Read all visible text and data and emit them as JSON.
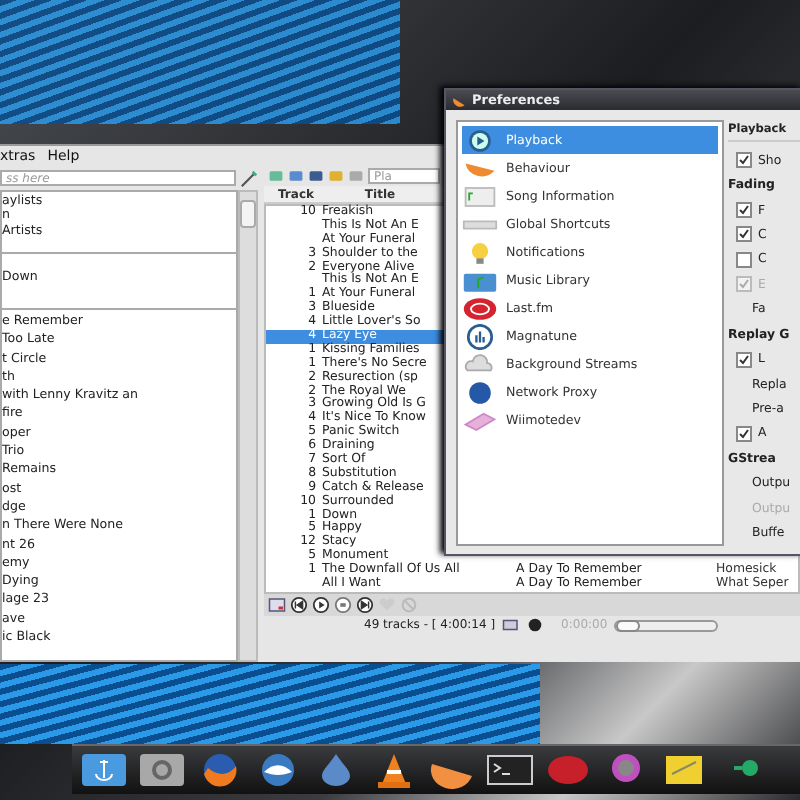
{
  "main_window": {
    "menu": [
      "xtras",
      "Help"
    ],
    "library": {
      "search": {
        "placeholder": "ss here"
      },
      "sections": [
        [
          "aylists",
          "n",
          "Artists"
        ],
        [
          "Down"
        ],
        [
          "e Remember",
          "Too Late",
          "t Circle",
          "th",
          "with Lenny Kravitz an",
          "fire",
          "oper",
          "Trio",
          "Remains",
          "ost",
          "dge",
          "n There Were None",
          "nt 26",
          "emy",
          "Dying",
          "lage 23",
          "ave",
          "ic Black"
        ]
      ]
    },
    "playlist": {
      "search": {
        "placeholder": "Pla"
      },
      "columns": [
        "Track",
        "Title"
      ],
      "rows": [
        {
          "track": "10",
          "title": "Freakish",
          "selected": false
        },
        {
          "title": "This Is Not An E",
          "selected": false
        },
        {
          "title": "At Your Funeral",
          "selected": false
        },
        {
          "track": "3",
          "title": "Shoulder to the",
          "selected": false
        },
        {
          "track": "2",
          "title": "Everyone Alive",
          "selected": false
        },
        {
          "title": "This Is Not An E",
          "selected": false
        },
        {
          "track": "1",
          "title": "At Your Funeral",
          "selected": false
        },
        {
          "track": "3",
          "title": "Blueside",
          "selected": false
        },
        {
          "track": "4",
          "title": "Little Lover's So",
          "selected": false
        },
        {
          "track": "4",
          "title": "Lazy Eye",
          "selected": true
        },
        {
          "track": "1",
          "title": "Kissing Families",
          "selected": false
        },
        {
          "track": "1",
          "title": "There's No Secre",
          "selected": false
        },
        {
          "track": "2",
          "title": "Resurection (sp",
          "selected": false
        },
        {
          "track": "2",
          "title": "The Royal We",
          "selected": false
        },
        {
          "track": "3",
          "title": "Growing Old Is G",
          "selected": false
        },
        {
          "track": "4",
          "title": "It's Nice To Know",
          "selected": false
        },
        {
          "track": "5",
          "title": "Panic Switch",
          "selected": false
        },
        {
          "track": "6",
          "title": "Draining",
          "selected": false
        },
        {
          "track": "7",
          "title": "Sort Of",
          "selected": false
        },
        {
          "track": "8",
          "title": "Substitution",
          "selected": false
        },
        {
          "track": "9",
          "title": "Catch & Release",
          "selected": false
        },
        {
          "track": "10",
          "title": "Surrounded",
          "selected": false
        },
        {
          "track": "1",
          "title": "Down",
          "selected": false
        },
        {
          "track": "5",
          "title": "Happy",
          "selected": false
        },
        {
          "track": "12",
          "title": "Stacy",
          "selected": false
        },
        {
          "track": "5",
          "title": "Monument",
          "selected": false
        },
        {
          "track": "1",
          "title": "The Downfall Of Us All",
          "artist": "A Day To Remember",
          "album": "Homesick",
          "selected": false
        },
        {
          "title": "All I Want",
          "artist": "A Day To Remember",
          "album": "What Seper",
          "selected": false
        }
      ]
    },
    "status": {
      "tracks": "49 tracks - [ 4:00:14 ]",
      "time": "0:00:00",
      "level": 0
    }
  },
  "preferences": {
    "title": "Preferences",
    "pages": [
      {
        "label": "Playback",
        "selected": true
      },
      {
        "label": "Behaviour",
        "selected": false
      },
      {
        "label": "Song Information",
        "selected": false
      },
      {
        "label": "Global Shortcuts",
        "selected": false
      },
      {
        "label": "Notifications",
        "selected": false
      },
      {
        "label": "Music Library",
        "selected": false
      },
      {
        "label": "Last.fm",
        "selected": false
      },
      {
        "label": "Magnatune",
        "selected": false
      },
      {
        "label": "Background Streams",
        "selected": false
      },
      {
        "label": "Network Proxy",
        "selected": false
      },
      {
        "label": "Wiimotedev",
        "selected": false
      }
    ],
    "settings": [
      {
        "kind": "title",
        "text": "Playback"
      },
      {
        "kind": "check",
        "text": "Sho",
        "checked": true,
        "disabled": false
      },
      {
        "kind": "heading",
        "text": "Fading"
      },
      {
        "kind": "check",
        "text": "F",
        "checked": true,
        "disabled": false
      },
      {
        "kind": "check",
        "text": "C",
        "checked": true,
        "disabled": false
      },
      {
        "kind": "check",
        "text": "C",
        "checked": false,
        "disabled": false
      },
      {
        "kind": "check",
        "text": "E",
        "checked": true,
        "disabled": true
      },
      {
        "kind": "label",
        "text": "Fa",
        "disabled": false
      },
      {
        "kind": "heading",
        "text": "Replay G"
      },
      {
        "kind": "check",
        "text": "L",
        "checked": true,
        "disabled": false
      },
      {
        "kind": "label",
        "text": "Repla",
        "disabled": false
      },
      {
        "kind": "label",
        "text": "Pre-a",
        "disabled": false
      },
      {
        "kind": "check",
        "text": "A",
        "checked": true,
        "disabled": false
      },
      {
        "kind": "heading",
        "text": "GStrea"
      },
      {
        "kind": "label",
        "text": "Outpu",
        "disabled": false
      },
      {
        "kind": "label",
        "text": "Outpu",
        "disabled": true
      },
      {
        "kind": "label",
        "text": "Buffe",
        "disabled": false
      }
    ]
  }
}
